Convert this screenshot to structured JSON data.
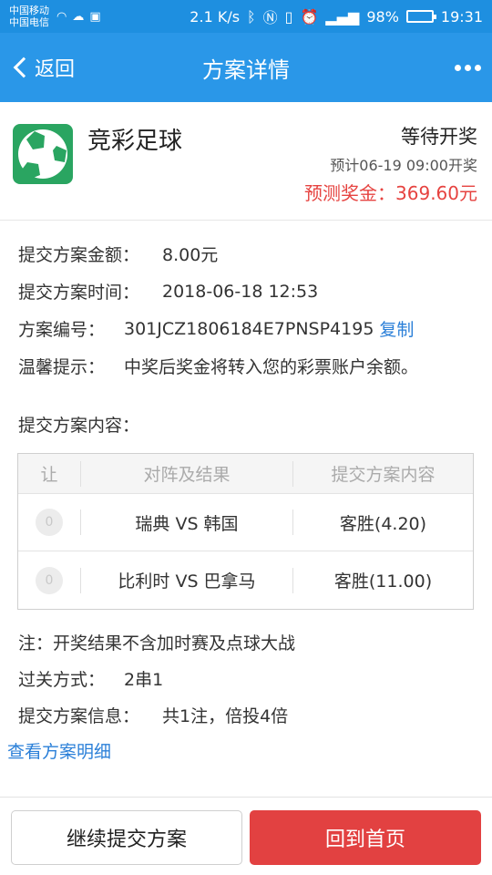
{
  "status_bar": {
    "carrier1": "中国移动",
    "carrier2": "中国电信",
    "speed": "2.1 K/s",
    "battery": "98%",
    "battery_level": 0.98,
    "time": "19:31"
  },
  "nav": {
    "back_label": "返回",
    "title": "方案详情"
  },
  "header": {
    "lottery_name": "竞彩足球",
    "status": "等待开奖",
    "draw_time": "预计06-19 09:00开奖",
    "prize_label": "预测奖金：",
    "prize_value": "369.60元"
  },
  "info": {
    "amount_label": "提交方案金额：",
    "amount_value": "8.00元",
    "time_label": "提交方案时间：",
    "time_value": "2018-06-18 12:53",
    "id_label": "方案编号：",
    "id_value": "301JCZ1806184E7PNSP4195",
    "copy_label": "复制",
    "tip_label": "温馨提示：",
    "tip_value": "中奖后奖金将转入您的彩票账户余额。"
  },
  "content_title": "提交方案内容：",
  "table": {
    "headers": [
      "让",
      "对阵及结果",
      "提交方案内容"
    ],
    "rows": [
      {
        "handicap": "0",
        "match": "瑞典 VS 韩国",
        "pick": "客胜(4.20)"
      },
      {
        "handicap": "0",
        "match": "比利时 VS 巴拿马",
        "pick": "客胜(11.00)"
      }
    ]
  },
  "notes": {
    "note": "注：开奖结果不含加时赛及点球大战",
    "pass_label": "过关方式：",
    "pass_value": "2串1",
    "plan_info_label": "提交方案信息：",
    "plan_info_value": "共1注，倍投4倍"
  },
  "detail_link": "查看方案明细",
  "buttons": {
    "continue": "继续提交方案",
    "home": "回到首页"
  },
  "colors": {
    "nav_bg": "#2a97e8",
    "accent_red": "#e24141",
    "link_blue": "#2a7fd8",
    "logo_green": "#2aa561"
  }
}
